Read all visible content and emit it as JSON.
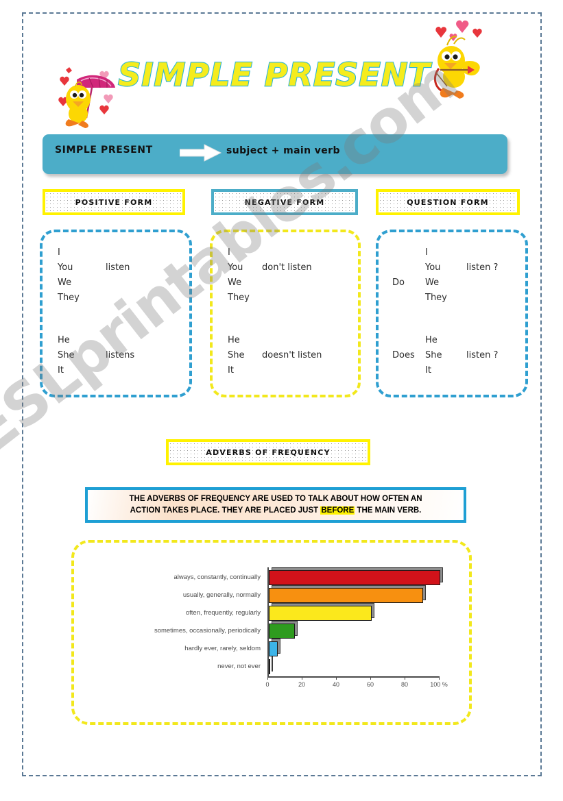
{
  "worksheet": {
    "title": "SIMPLE PRESENT",
    "watermark": "ESLprintables.com"
  },
  "formula": {
    "label": "SIMPLE PRESENT",
    "arrow_icon": "right-arrow-icon",
    "value": "subject + main verb"
  },
  "sections": {
    "positive": {
      "header": "POSITIVE FORM",
      "header_border_color": "#fff200",
      "box_border_color": "#2f9fd0",
      "group1": {
        "pronouns": [
          "I",
          "You",
          "We",
          "They"
        ],
        "auxiliary": "",
        "verb": "listen"
      },
      "group2": {
        "pronouns": [
          "He",
          "She",
          "It"
        ],
        "auxiliary": "",
        "verb": "listens"
      }
    },
    "negative": {
      "header": "NEGATIVE FORM",
      "header_border_color": "#4cadc8",
      "box_border_color": "#f2e81c",
      "group1": {
        "pronouns": [
          "I",
          "You",
          "We",
          "They"
        ],
        "auxiliary": "",
        "verb": "don't  listen"
      },
      "group2": {
        "pronouns": [
          "He",
          "She",
          "It"
        ],
        "auxiliary": "",
        "verb": "doesn't  listen"
      }
    },
    "question": {
      "header": "QUESTION FORM",
      "header_border_color": "#fff200",
      "box_border_color": "#2f9fd0",
      "group1": {
        "pronouns": [
          "I",
          "You",
          "We",
          "They"
        ],
        "auxiliary": "Do",
        "verb": "listen ?"
      },
      "group2": {
        "pronouns": [
          "He",
          "She",
          "It"
        ],
        "auxiliary": "Does",
        "verb": "listen ?"
      }
    }
  },
  "adverbs": {
    "header": "ADVERBS OF FREQUENCY",
    "info_line1": "THE ADVERBS OF FREQUENCY ARE USED TO TALK ABOUT HOW OFTEN AN",
    "info_line2_a": "ACTION TAKES PLACE.  THEY ARE PLACED JUST ",
    "info_highlight": "BEFORE",
    "info_line2_b": " THE MAIN VERB."
  },
  "chart_data": {
    "type": "bar",
    "orientation": "horizontal",
    "title": "",
    "xlabel": "%",
    "ylabel": "",
    "xlim": [
      0,
      100
    ],
    "xticks": [
      0,
      20,
      40,
      60,
      80,
      100
    ],
    "xtick_labels": [
      "0",
      "20",
      "40",
      "60",
      "80",
      "100 %"
    ],
    "grid": false,
    "legend": "none",
    "categories": [
      "always, constantly, continually",
      "usually, generally, normally",
      "often, frequently, regularly",
      "sometimes, occasionally, periodically",
      "hardly ever, rarely, seldom",
      "never, not ever"
    ],
    "values": [
      100,
      90,
      60,
      15,
      5,
      0
    ],
    "colors": [
      "#d2121a",
      "#f79010",
      "#fbe81c",
      "#2e9b1e",
      "#3cb4e8",
      "#ffffff"
    ]
  }
}
